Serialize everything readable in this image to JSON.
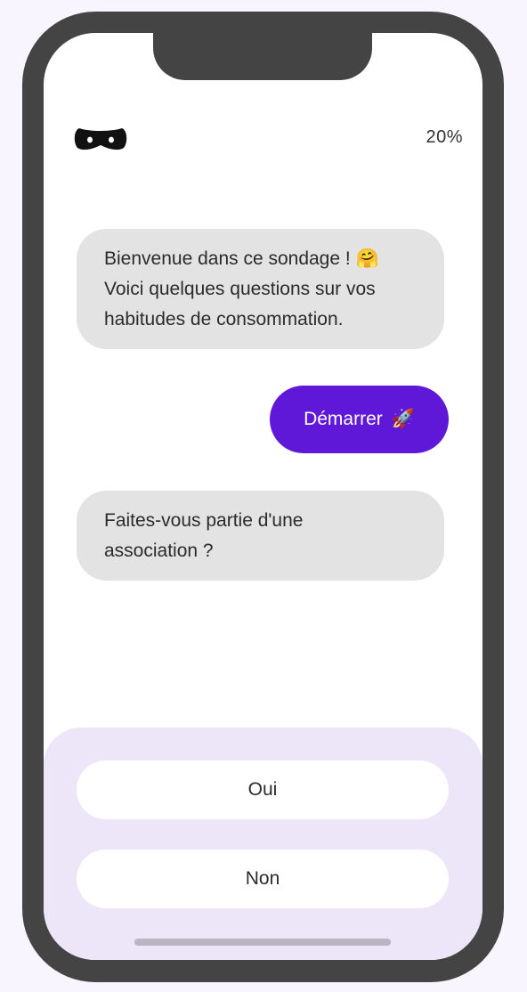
{
  "header": {
    "logo_icon": "mask-icon",
    "progress": "20%"
  },
  "chat": {
    "messages": [
      {
        "from": "bot",
        "text": "Bienvenue dans ce sondage ! 🤗\nVoici quelques questions sur vos\nhabitudes de consommation."
      },
      {
        "from": "user",
        "text": "Démarrer",
        "emoji": "🚀"
      },
      {
        "from": "bot",
        "text": "Faites-vous partie d'une\nassociation ?"
      }
    ]
  },
  "answers": {
    "options": [
      "Oui",
      "Non"
    ]
  },
  "colors": {
    "accent": "#5f18d8",
    "bot_bubble": "#e3e3e3",
    "panel": "#ede6f8",
    "frame": "#444444"
  }
}
